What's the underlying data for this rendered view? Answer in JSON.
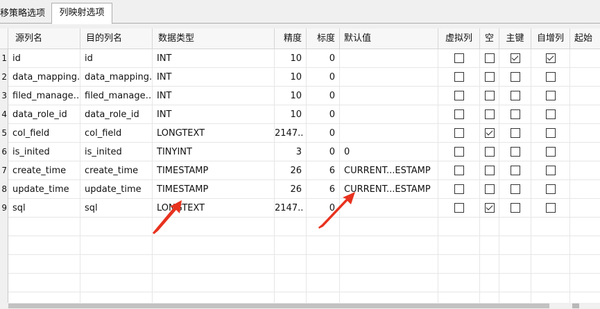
{
  "tabs": [
    {
      "label": "移策略选项",
      "active": false
    },
    {
      "label": "列映射选项",
      "active": true
    }
  ],
  "columns": {
    "source": "源列名",
    "target": "目的列名",
    "type": "数据类型",
    "precision": "精度",
    "scale": "标度",
    "default": "默认值",
    "virtual": "虚拟列",
    "nullable": "空",
    "primary": "主键",
    "autoinc": "自增列",
    "start": "起始"
  },
  "rows": [
    {
      "num": "1",
      "source": "id",
      "target": "id",
      "type": "INT",
      "precision": "10",
      "scale": "0",
      "default": "",
      "virtual": false,
      "nullable": false,
      "primary": true,
      "autoinc": true
    },
    {
      "num": "2",
      "source": "data_mapping.",
      "target": "data_mapping.",
      "type": "INT",
      "precision": "10",
      "scale": "0",
      "default": "",
      "virtual": false,
      "nullable": false,
      "primary": false,
      "autoinc": false
    },
    {
      "num": "3",
      "source": "filed_manage…",
      "target": "filed_manage…",
      "type": "INT",
      "precision": "10",
      "scale": "0",
      "default": "",
      "virtual": false,
      "nullable": false,
      "primary": false,
      "autoinc": false
    },
    {
      "num": "4",
      "source": "data_role_id",
      "target": "data_role_id",
      "type": "INT",
      "precision": "10",
      "scale": "0",
      "default": "",
      "virtual": false,
      "nullable": false,
      "primary": false,
      "autoinc": false
    },
    {
      "num": "5",
      "source": "col_field",
      "target": "col_field",
      "type": "LONGTEXT",
      "precision": "2147..",
      "scale": "0",
      "default": "",
      "virtual": false,
      "nullable": true,
      "primary": false,
      "autoinc": false
    },
    {
      "num": "6",
      "source": "is_inited",
      "target": "is_inited",
      "type": "TINYINT",
      "precision": "3",
      "scale": "0",
      "default": "0",
      "virtual": false,
      "nullable": false,
      "primary": false,
      "autoinc": false
    },
    {
      "num": "7",
      "source": "create_time",
      "target": "create_time",
      "type": "TIMESTAMP",
      "precision": "26",
      "scale": "6",
      "default": "CURRENT...ESTAMP",
      "virtual": false,
      "nullable": false,
      "primary": false,
      "autoinc": false
    },
    {
      "num": "8",
      "source": "update_time",
      "target": "update_time",
      "type": "TIMESTAMP",
      "precision": "26",
      "scale": "6",
      "default": "CURRENT...ESTAMP",
      "virtual": false,
      "nullable": false,
      "primary": false,
      "autoinc": false
    },
    {
      "num": "9",
      "source": "sql",
      "target": "sql",
      "type": "LONGTEXT",
      "precision": "2147..",
      "scale": "0",
      "default": "",
      "virtual": false,
      "nullable": true,
      "primary": false,
      "autoinc": false
    }
  ],
  "colors": {
    "annotation_arrow": "#e8321e",
    "grid_line": "#e6e6e6",
    "header_bg": "#f7f7f7"
  },
  "icons": {
    "checkbox_checked": "checkbox-checked-icon",
    "checkbox_unchecked": "checkbox-unchecked-icon",
    "annotation": "red-arrow-icon"
  }
}
